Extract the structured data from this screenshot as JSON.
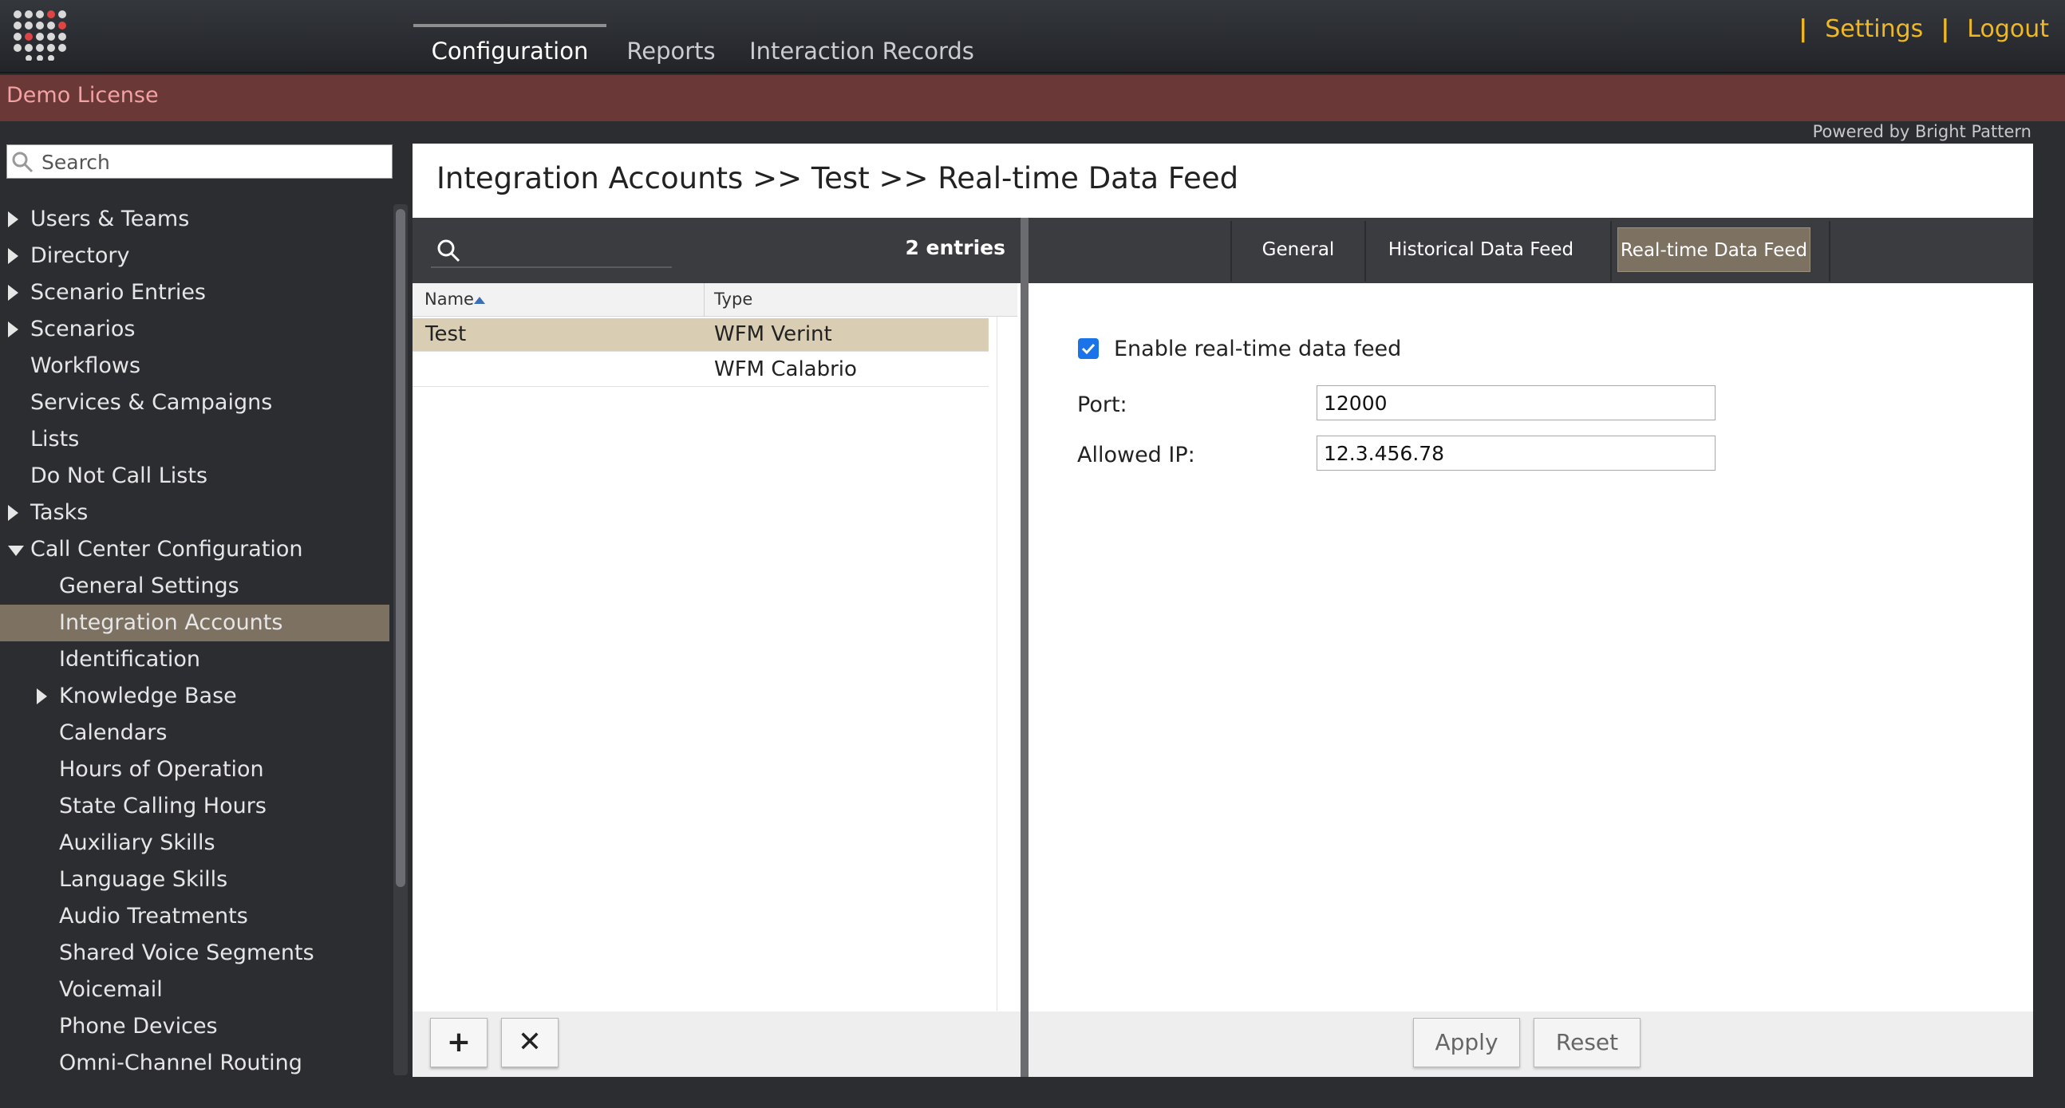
{
  "topbar": {
    "nav_tabs": [
      {
        "label": "Configuration",
        "active": true
      },
      {
        "label": "Reports",
        "active": false
      },
      {
        "label": "Interaction Records",
        "active": false
      }
    ],
    "separator": "|",
    "settings_label": "Settings",
    "logout_label": "Logout",
    "link_color": "#f0b825"
  },
  "license": {
    "text": "Demo License",
    "bar_color": "#6b3838"
  },
  "powered_by": "Powered by Bright Pattern",
  "sidebar": {
    "search_placeholder": "Search",
    "items": [
      {
        "label": "Users & Teams",
        "expander": "collapsed"
      },
      {
        "label": "Directory",
        "expander": "collapsed"
      },
      {
        "label": "Scenario Entries",
        "expander": "collapsed"
      },
      {
        "label": "Scenarios",
        "expander": "collapsed"
      },
      {
        "label": "Workflows",
        "expander": "none"
      },
      {
        "label": "Services & Campaigns",
        "expander": "none"
      },
      {
        "label": "Lists",
        "expander": "none"
      },
      {
        "label": "Do Not Call Lists",
        "expander": "none"
      },
      {
        "label": "Tasks",
        "expander": "collapsed"
      },
      {
        "label": "Call Center Configuration",
        "expander": "expanded"
      },
      {
        "label": "General Settings",
        "expander": "none",
        "child": true
      },
      {
        "label": "Integration Accounts",
        "expander": "none",
        "child": true,
        "selected": true
      },
      {
        "label": "Identification",
        "expander": "none",
        "child": true
      },
      {
        "label": "Knowledge Base",
        "expander": "collapsed",
        "child": true
      },
      {
        "label": "Calendars",
        "expander": "none",
        "child": true
      },
      {
        "label": "Hours of Operation",
        "expander": "none",
        "child": true
      },
      {
        "label": "State Calling Hours",
        "expander": "none",
        "child": true
      },
      {
        "label": "Auxiliary Skills",
        "expander": "none",
        "child": true
      },
      {
        "label": "Language Skills",
        "expander": "none",
        "child": true
      },
      {
        "label": "Audio Treatments",
        "expander": "none",
        "child": true
      },
      {
        "label": "Shared Voice Segments",
        "expander": "none",
        "child": true
      },
      {
        "label": "Voicemail",
        "expander": "none",
        "child": true
      },
      {
        "label": "Phone Devices",
        "expander": "none",
        "child": true
      },
      {
        "label": "Omni-Channel Routing",
        "expander": "none",
        "child": true
      }
    ],
    "selected_color": "#7d7161"
  },
  "main": {
    "title": "Integration Accounts >> Test >> Real-time Data Feed",
    "list": {
      "entries_label": "2 entries",
      "columns": [
        "Name",
        "Type"
      ],
      "sort": {
        "column": "Name",
        "direction": "ascending"
      },
      "rows": [
        {
          "name": "Test",
          "type": "WFM Verint",
          "selected": true
        },
        {
          "name": "",
          "type": "WFM Calabrio",
          "selected": false
        }
      ],
      "add_label": "+",
      "delete_label": "✕"
    },
    "detail": {
      "tabs": [
        {
          "label": "General",
          "active": false
        },
        {
          "label": "Historical Data Feed",
          "active": false
        },
        {
          "label": "Real-time Data Feed",
          "active": true
        }
      ],
      "enable_label": "Enable real-time data feed",
      "enable_checked": true,
      "port_label": "Port:",
      "port_value": "12000",
      "allowed_ip_label": "Allowed IP:",
      "allowed_ip_value": "12.3.456.78",
      "apply_label": "Apply",
      "reset_label": "Reset"
    }
  }
}
